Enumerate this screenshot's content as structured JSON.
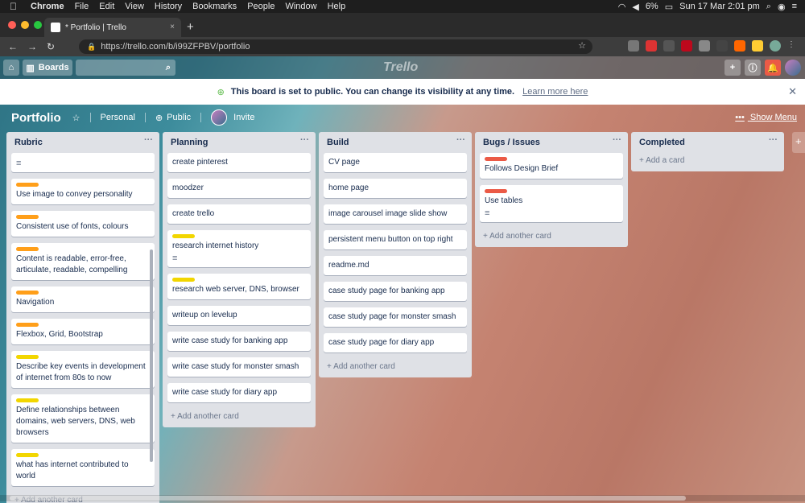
{
  "macmenu": {
    "apple": "",
    "app": "Chrome",
    "items": [
      "File",
      "Edit",
      "View",
      "History",
      "Bookmarks",
      "People",
      "Window",
      "Help"
    ],
    "battery": "6%",
    "clock": "Sun 17 Mar  2:01 pm"
  },
  "browser": {
    "tab_title": "* Portfolio | Trello",
    "url": "https://trello.com/b/i99ZFPBV/portfolio"
  },
  "header": {
    "boards_label": "Boards",
    "logo": "Trello"
  },
  "banner": {
    "message": "This board is set to public. You can change its visibility at any time.",
    "link": "Learn more here"
  },
  "board": {
    "title": "Portfolio",
    "team": "Personal",
    "visibility": "Public",
    "invite": "Invite",
    "show_menu": "Show Menu",
    "add_another_card": "+ Add another card",
    "add_a_card": "+ Add a card"
  },
  "lists": [
    {
      "title": "Rubric",
      "cards": [
        {
          "text": "",
          "label": "",
          "has_desc": true
        },
        {
          "text": "Use image to convey personality",
          "label": "#ff9f1a"
        },
        {
          "text": "Consistent use of fonts, colours",
          "label": "#ff9f1a"
        },
        {
          "text": "Content is readable, error-free, articulate, readable, compelling",
          "label": "#ff9f1a"
        },
        {
          "text": "Navigation",
          "label": "#ff9f1a"
        },
        {
          "text": "Flexbox, Grid, Bootstrap",
          "label": "#ff9f1a"
        },
        {
          "text": "Describe key events in development of internet from 80s to now",
          "label": "#f2d600"
        },
        {
          "text": "Define relationships between domains, web servers, DNS, web browsers",
          "label": "#f2d600"
        },
        {
          "text": "what has internet contributed to world",
          "label": "#f2d600"
        }
      ]
    },
    {
      "title": "Planning",
      "cards": [
        {
          "text": "create pinterest"
        },
        {
          "text": "moodzer"
        },
        {
          "text": "create trello"
        },
        {
          "text": "research internet history",
          "label": "#f2d600",
          "has_desc": true
        },
        {
          "text": "research web server, DNS, browser",
          "label": "#f2d600"
        },
        {
          "text": "writeup on levelup"
        },
        {
          "text": "write case study for banking app"
        },
        {
          "text": "write case study for monster smash"
        },
        {
          "text": "write case study for diary app"
        }
      ]
    },
    {
      "title": "Build",
      "cards": [
        {
          "text": "CV page"
        },
        {
          "text": "home page"
        },
        {
          "text": "image carousel image slide show"
        },
        {
          "text": "persistent menu button on top right"
        },
        {
          "text": "readme.md"
        },
        {
          "text": "case study page for banking app"
        },
        {
          "text": "case study page for monster smash"
        },
        {
          "text": "case study page for diary app"
        }
      ]
    },
    {
      "title": "Bugs / Issues",
      "cards": [
        {
          "text": "Follows Design Brief",
          "label": "#eb5a46"
        },
        {
          "text": "Use tables",
          "label": "#eb5a46",
          "has_desc": true
        }
      ]
    },
    {
      "title": "Completed",
      "cards": []
    }
  ]
}
